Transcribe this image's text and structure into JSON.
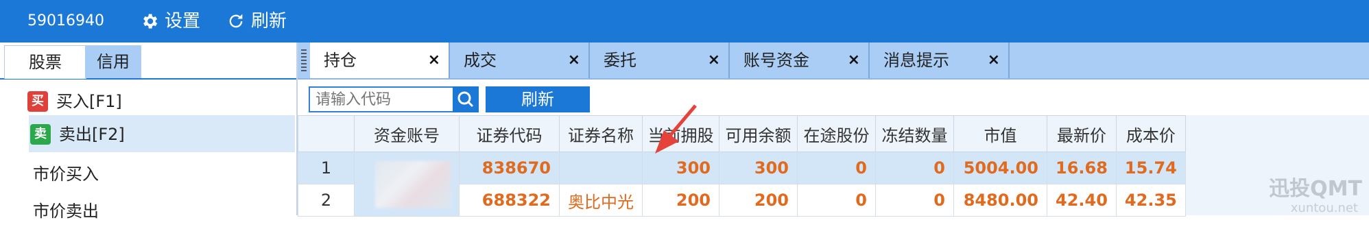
{
  "topbar": {
    "account": "59016940",
    "settings_label": "设置",
    "refresh_label": "刷新",
    "bg_color": "#1b78d6"
  },
  "left": {
    "tabs": [
      "股票",
      "信用"
    ],
    "menu": [
      {
        "label": "买入[F1]",
        "badge": "买",
        "badge_color": "#e0403a"
      },
      {
        "label": "卖出[F2]",
        "badge": "卖",
        "badge_color": "#2aa84a"
      },
      {
        "label": "市价买入"
      },
      {
        "label": "市价卖出"
      }
    ]
  },
  "tabs": [
    {
      "label": "持仓",
      "close": "×"
    },
    {
      "label": "成交",
      "close": "×"
    },
    {
      "label": "委托",
      "close": "×"
    },
    {
      "label": "账号资金",
      "close": "×"
    },
    {
      "label": "消息提示",
      "close": "×"
    }
  ],
  "toolbar": {
    "search_placeholder": "请输入代码",
    "refresh_label": "刷新"
  },
  "table": {
    "columns": [
      "资金账号",
      "证券代码",
      "证券名称",
      "当前拥股",
      "可用余额",
      "在途股份",
      "冻结数量",
      "市值",
      "最新价",
      "成本价"
    ],
    "rows": [
      {
        "idx": "1",
        "code": "838670",
        "name": "",
        "hold": "300",
        "avail": "300",
        "transit": "0",
        "frozen": "0",
        "mv": "5004.00",
        "last": "16.68",
        "cost": "15.74"
      },
      {
        "idx": "2",
        "code": "688322",
        "name": "奥比中光",
        "hold": "200",
        "avail": "200",
        "transit": "0",
        "frozen": "0",
        "mv": "8480.00",
        "last": "42.40",
        "cost": "42.35"
      }
    ]
  },
  "watermark": {
    "main": "迅投QMT",
    "sub": "xuntou.net"
  }
}
